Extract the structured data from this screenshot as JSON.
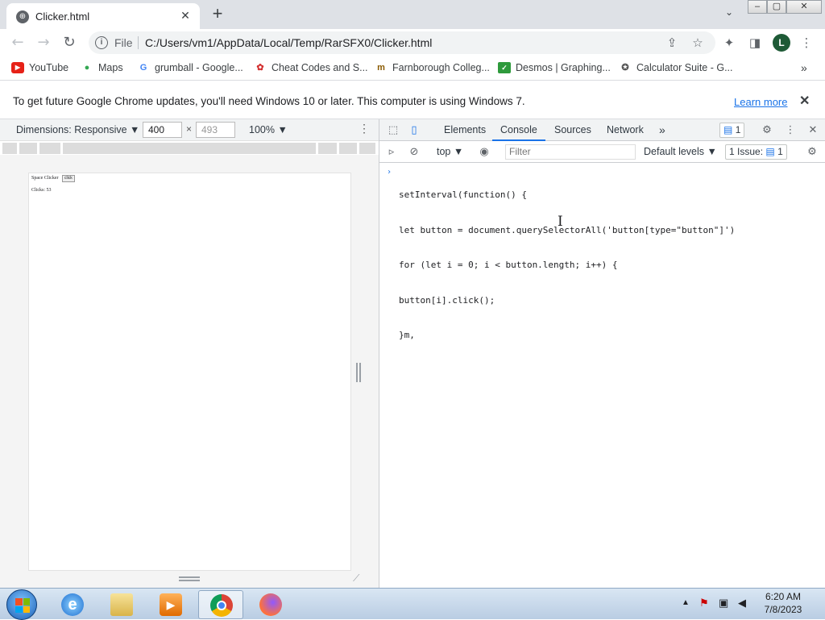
{
  "tab": {
    "title": "Clicker.html",
    "favicon": "globe-icon",
    "close": "✕"
  },
  "new_tab": "+",
  "window_controls": {
    "minimize": "–",
    "maximize": "▢",
    "close": "✕"
  },
  "address": {
    "scheme_label": "File",
    "url": "C:/Users/vm1/AppData/Local/Temp/RarSFX0/Clicker.html"
  },
  "profile_initial": "L",
  "bookmarks": [
    {
      "label": "YouTube",
      "icon": "youtube-icon"
    },
    {
      "label": "Maps",
      "icon": "maps-icon"
    },
    {
      "label": "grumball - Google...",
      "icon": "google-icon"
    },
    {
      "label": "Cheat Codes and S...",
      "icon": "cheat-codes-icon"
    },
    {
      "label": "Farnborough Colleg...",
      "icon": "farnborough-icon"
    },
    {
      "label": "Desmos | Graphing...",
      "icon": "desmos-icon"
    },
    {
      "label": "Calculator Suite - G...",
      "icon": "calculator-icon"
    }
  ],
  "bookmarks_overflow": "»",
  "infobar": {
    "message": "To get future Google Chrome updates, you'll need Windows 10 or later. This computer is using Windows 7.",
    "link": "Learn more"
  },
  "device_toolbar": {
    "dimensions_label": "Dimensions: Responsive ▼",
    "width": "400",
    "times": "×",
    "height": "493",
    "zoom": "100% ▼"
  },
  "page_preview": {
    "title": "Space Clicker",
    "button": "click",
    "clicks": "Clicks: 53"
  },
  "devtools": {
    "tabs": [
      "Elements",
      "Console",
      "Sources",
      "Network"
    ],
    "active_tab": "Console",
    "more_tabs": "»",
    "messages_badge": "1",
    "context": "top ▼",
    "filter_placeholder": "Filter",
    "levels": "Default levels ▼",
    "issues_label": "1 Issue:",
    "issues_count": "1"
  },
  "console": {
    "prompt": "›",
    "lines": [
      "setInterval(function() {",
      "let button = document.querySelectorAll('button[type=\"button\"]')",
      "for (let i = 0; i < button.length; i++) {",
      "button[i].click();",
      "}m,"
    ]
  },
  "clock": {
    "time": "6:20 AM",
    "date": "7/8/2023"
  },
  "colors": {
    "accent": "#1a73e8",
    "tabbar": "#dee1e6",
    "avatar": "#1e5a36"
  }
}
